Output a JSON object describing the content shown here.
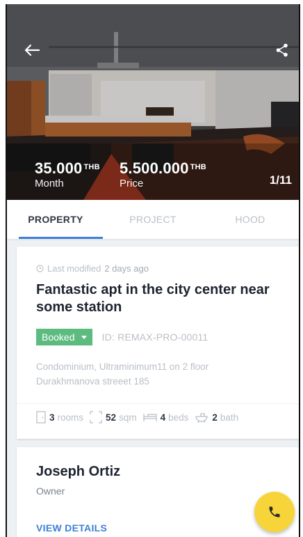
{
  "header": {
    "rent_price": "35.000",
    "rent_currency": "THB",
    "rent_label": "Month",
    "sale_price": "5.500.000",
    "sale_currency": "THB",
    "sale_label": "Price",
    "photo_counter": "1/11",
    "back_icon": "arrow-left-icon",
    "share_icon": "share-icon"
  },
  "tabs": [
    {
      "label": "PROPERTY",
      "active": true
    },
    {
      "label": "PROJECT",
      "active": false
    },
    {
      "label": "HOOD",
      "active": false
    }
  ],
  "property": {
    "modified_prefix": "Last modified",
    "modified_value": "2 days ago",
    "title": "Fantastic apt in the city center near some station",
    "status": "Booked",
    "status_color": "#5dbb80",
    "id_text": "ID: REMAX-PRO-00011",
    "address_line1": "Condominium, Ultraminimum11 on 2 floor",
    "address_line2": "Durakhmanova streeet 185",
    "features": {
      "rooms_value": "3",
      "rooms_label": "rooms",
      "area_value": "52",
      "area_label": "sqm",
      "beds_value": "4",
      "beds_label": "beds",
      "bath_value": "2",
      "bath_label": "bath"
    }
  },
  "owner": {
    "name": "Joseph Ortiz",
    "role": "Owner",
    "link_label": "VIEW DETAILS"
  },
  "colors": {
    "accent": "#3d7fd6",
    "fab": "#f6d43a"
  }
}
